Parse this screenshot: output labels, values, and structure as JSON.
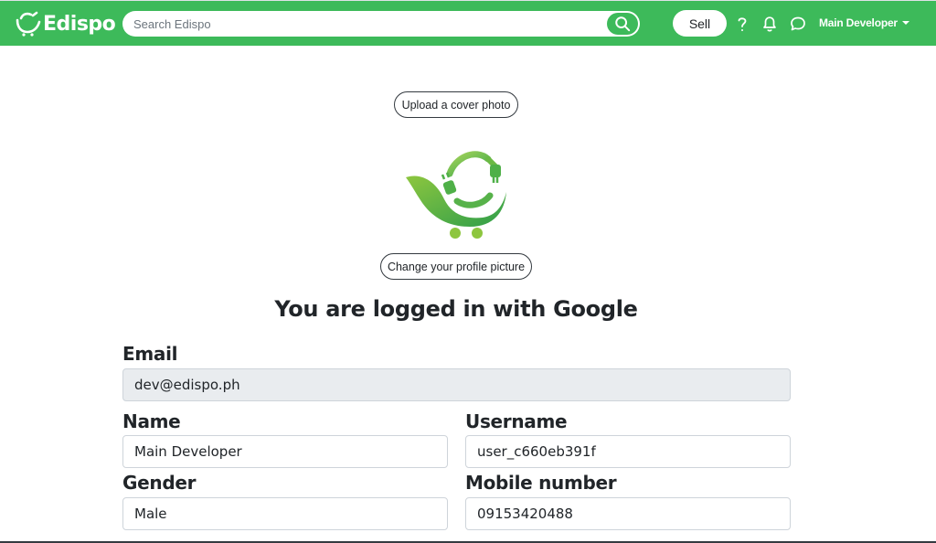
{
  "header": {
    "brand": "Edispo",
    "search_placeholder": "Search Edispo",
    "sell_label": "Sell",
    "user_name": "Main Developer"
  },
  "profile": {
    "cover_button": "Upload a cover photo",
    "picture_button": "Change your profile picture",
    "login_notice": "You are logged in with Google"
  },
  "form": {
    "email": {
      "label": "Email",
      "value": "dev@edispo.ph"
    },
    "name": {
      "label": "Name",
      "value": "Main Developer"
    },
    "username": {
      "label": "Username",
      "value": "user_c660eb391f"
    },
    "gender": {
      "label": "Gender",
      "value": "Male"
    },
    "mobile": {
      "label": "Mobile number",
      "value": "09153420488"
    }
  },
  "colors": {
    "brand_green": "#3dba5a",
    "readonly_bg": "#e9ecef"
  },
  "icons": [
    "cart-logo-icon",
    "search-icon",
    "help-icon",
    "bell-icon",
    "chat-icon",
    "chevron-down-icon"
  ]
}
